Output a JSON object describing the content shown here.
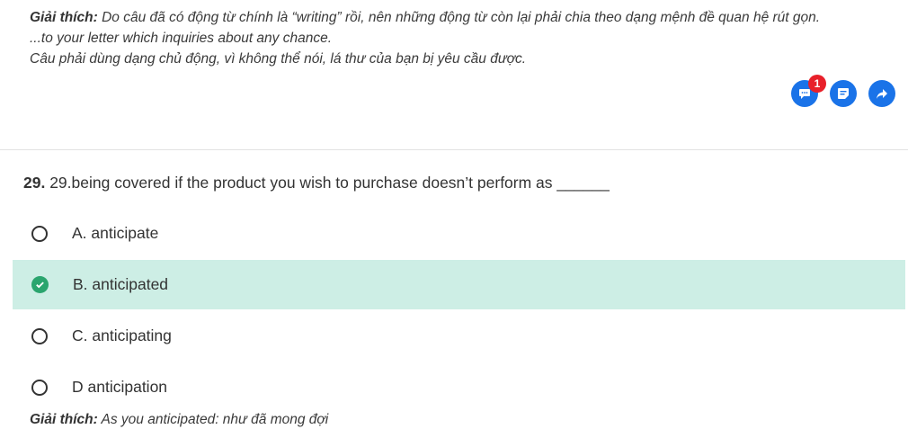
{
  "explanation_top": {
    "label": "Giải thích:",
    "line1": " Do câu đã có động từ chính là “writing” rồi, nên những động từ còn lại phải chia theo dạng mệnh đề quan hệ rút gọn.",
    "line2": "...to your letter which inquiries about any chance.",
    "line3": "Câu phải dùng dạng chủ động, vì không thể nói, lá thư của bạn bị yêu cầu được."
  },
  "actions": {
    "comment_badge": "1",
    "icons": [
      "comment-icon",
      "note-icon",
      "share-icon"
    ],
    "color": "#1a73e8",
    "badge_color": "#e8202a"
  },
  "question": {
    "number": "29.",
    "text": " 29.being covered if the product you wish to purchase doesn’t perform as ______"
  },
  "options": [
    {
      "label": "A. anticipate",
      "correct": false
    },
    {
      "label": "B. anticipated",
      "correct": true
    },
    {
      "label": "C. anticipating",
      "correct": false
    },
    {
      "label": "D anticipation",
      "correct": false
    }
  ],
  "explanation_bottom": {
    "label": "Giải thích:",
    "text": " As you anticipated: như đã mong đợi"
  },
  "colors": {
    "correct_bg": "#cdeee5",
    "check": "#2aa56e"
  }
}
